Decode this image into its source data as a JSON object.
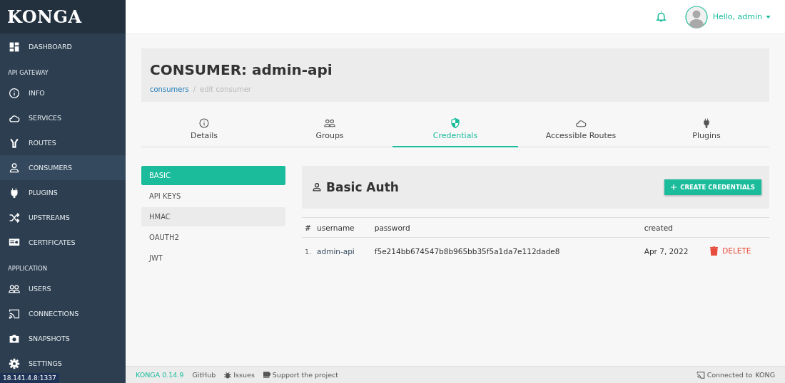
{
  "sidebar": {
    "logo": "KONGA",
    "sections": [
      {
        "items": [
          {
            "label": "DASHBOARD",
            "kind": "dashboard",
            "selected": false
          }
        ]
      },
      {
        "heading": "API GATEWAY",
        "items": [
          {
            "label": "INFO",
            "kind": "info",
            "selected": false
          },
          {
            "label": "SERVICES",
            "kind": "cloud",
            "selected": false
          },
          {
            "label": "ROUTES",
            "kind": "fork",
            "selected": false
          },
          {
            "label": "CONSUMERS",
            "kind": "user",
            "selected": true
          },
          {
            "label": "PLUGINS",
            "kind": "plug",
            "selected": false
          },
          {
            "label": "UPSTREAMS",
            "kind": "shuffle",
            "selected": false
          },
          {
            "label": "CERTIFICATES",
            "kind": "cert",
            "selected": false
          }
        ]
      },
      {
        "heading": "APPLICATION",
        "items": [
          {
            "label": "USERS",
            "kind": "users",
            "selected": false
          },
          {
            "label": "CONNECTIONS",
            "kind": "cast",
            "selected": false
          },
          {
            "label": "SNAPSHOTS",
            "kind": "camera",
            "selected": false
          },
          {
            "label": "SETTINGS",
            "kind": "gear",
            "selected": false
          }
        ]
      }
    ]
  },
  "status_url": "18.141.4.8:1337",
  "header": {
    "greeting": "Hello, admin"
  },
  "page": {
    "title": "CONSUMER: admin-api",
    "breadcrumb": {
      "items": [
        "consumers",
        "edit consumer"
      ],
      "separator": "/"
    }
  },
  "tabs": [
    {
      "label": "Details",
      "kind": "info",
      "selected": false
    },
    {
      "label": "Groups",
      "kind": "users",
      "selected": false
    },
    {
      "label": "Credentials",
      "kind": "shield",
      "selected": true
    },
    {
      "label": "Accessible Routes",
      "kind": "cloud",
      "selected": false
    },
    {
      "label": "Plugins",
      "kind": "plug",
      "selected": false
    }
  ],
  "credential_types": [
    {
      "label": "BASIC",
      "selected": true,
      "hovered": false
    },
    {
      "label": "API KEYS",
      "selected": false,
      "hovered": false
    },
    {
      "label": "HMAC",
      "selected": false,
      "hovered": true
    },
    {
      "label": "OAUTH2",
      "selected": false,
      "hovered": false
    },
    {
      "label": "JWT",
      "selected": false,
      "hovered": false
    }
  ],
  "panel": {
    "title": "Basic Auth",
    "button": "CREATE CREDENTIALS"
  },
  "table": {
    "columns": [
      "#",
      "username",
      "password",
      "created"
    ],
    "rows": [
      {
        "index": "1.",
        "username": "admin-api",
        "password": "f5e214bb674547b8b965bb35f5a1da7e112dade8",
        "created": "Apr 7, 2022",
        "action": "DELETE"
      }
    ]
  },
  "footer": {
    "version": "KONGA 0.14.9",
    "links": [
      {
        "label": "GitHub",
        "kind": "plain"
      },
      {
        "label": "Issues",
        "kind": "bug"
      },
      {
        "label": "Support the project",
        "kind": "cup"
      }
    ],
    "connection": "Connected to",
    "connection_target": "KONG"
  }
}
